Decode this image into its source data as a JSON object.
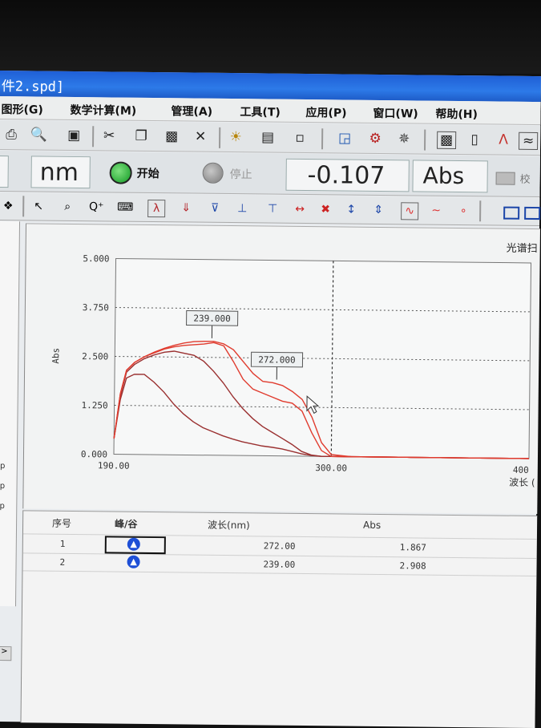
{
  "window": {
    "title": "件2.spd]"
  },
  "menu": [
    "图形(G)",
    "数学计算(M)",
    "管理(A)",
    "工具(T)",
    "应用(P)",
    "窗口(W)",
    "帮助(H)"
  ],
  "toolbar": {
    "unit": "nm",
    "start_label": "开始",
    "stop_label": "停止",
    "reading": "-0.107",
    "reading_unit": "Abs",
    "cut_label": "校"
  },
  "side_labels": [
    "sp",
    "sp",
    "sp"
  ],
  "chart_data": {
    "type": "line",
    "title": "光谱扫",
    "xlabel": "波长 (",
    "ylabel": "Abs",
    "x_ticks": [
      "190.00",
      "300.00",
      "400"
    ],
    "y_ticks": [
      "0.000",
      "1.250",
      "2.500",
      "3.750",
      "5.000"
    ],
    "xlim": [
      190,
      400
    ],
    "ylim": [
      0,
      5
    ],
    "cursor_x": 300,
    "series": [
      {
        "x": [
          190,
          193,
          196,
          200,
          205,
          210,
          215,
          220,
          225,
          230,
          235,
          240,
          245,
          250,
          255,
          260,
          265,
          270,
          275,
          280,
          285,
          290,
          295,
          300,
          310,
          320,
          340,
          360,
          380,
          400
        ],
        "y": [
          0.4,
          1.4,
          1.95,
          2.05,
          2.05,
          1.85,
          1.6,
          1.3,
          1.05,
          0.85,
          0.7,
          0.6,
          0.5,
          0.42,
          0.35,
          0.3,
          0.25,
          0.22,
          0.18,
          0.12,
          0.06,
          0.02,
          0.0,
          0.0,
          0,
          0,
          0,
          0,
          0,
          0
        ]
      },
      {
        "x": [
          190,
          193,
          196,
          200,
          205,
          210,
          215,
          220,
          225,
          230,
          235,
          240,
          245,
          250,
          255,
          260,
          265,
          270,
          275,
          280,
          285,
          290,
          295,
          300,
          310,
          320,
          340,
          360,
          380,
          400
        ],
        "y": [
          0.4,
          1.5,
          2.1,
          2.3,
          2.45,
          2.55,
          2.62,
          2.65,
          2.6,
          2.55,
          2.4,
          2.15,
          1.85,
          1.5,
          1.2,
          0.95,
          0.75,
          0.6,
          0.45,
          0.3,
          0.12,
          0.03,
          0.0,
          0.0,
          0,
          0,
          0,
          0,
          0,
          0
        ]
      },
      {
        "x": [
          190,
          193,
          196,
          200,
          205,
          210,
          215,
          220,
          225,
          230,
          235,
          240,
          245,
          250,
          255,
          260,
          265,
          270,
          275,
          280,
          285,
          290,
          295,
          300,
          310,
          320,
          340,
          360,
          380,
          400
        ],
        "y": [
          0.4,
          1.55,
          2.15,
          2.35,
          2.5,
          2.6,
          2.7,
          2.76,
          2.8,
          2.82,
          2.84,
          2.88,
          2.8,
          2.4,
          1.95,
          1.7,
          1.6,
          1.5,
          1.4,
          1.35,
          1.15,
          0.6,
          0.15,
          0.0,
          0,
          0,
          0,
          0,
          0,
          0
        ]
      },
      {
        "x": [
          190,
          193,
          196,
          200,
          205,
          210,
          215,
          220,
          225,
          230,
          235,
          240,
          245,
          250,
          255,
          260,
          265,
          270,
          275,
          280,
          285,
          290,
          295,
          300,
          310,
          320,
          340,
          360,
          380,
          400
        ],
        "y": [
          0.4,
          1.55,
          2.15,
          2.35,
          2.5,
          2.62,
          2.72,
          2.8,
          2.86,
          2.9,
          2.91,
          2.91,
          2.85,
          2.7,
          2.4,
          2.1,
          1.9,
          1.87,
          1.8,
          1.65,
          1.45,
          1.0,
          0.35,
          0.05,
          0,
          0,
          0,
          0,
          0,
          0
        ]
      }
    ],
    "peaks": [
      {
        "label": "239.000",
        "x": 239,
        "y": 2.908
      },
      {
        "label": "272.000",
        "x": 272,
        "y": 1.867
      }
    ]
  },
  "table": {
    "headers": [
      "序号",
      "峰/谷",
      "波长(nm)",
      "Abs"
    ],
    "rows": [
      {
        "index": "1",
        "wavelength": "272.00",
        "abs": "1.867"
      },
      {
        "index": "2",
        "wavelength": "239.00",
        "abs": "2.908"
      }
    ]
  },
  "colors": {
    "curve_dark": "#9a3030",
    "curve_red": "#e03b2e",
    "titlebar": "#2466d8"
  }
}
